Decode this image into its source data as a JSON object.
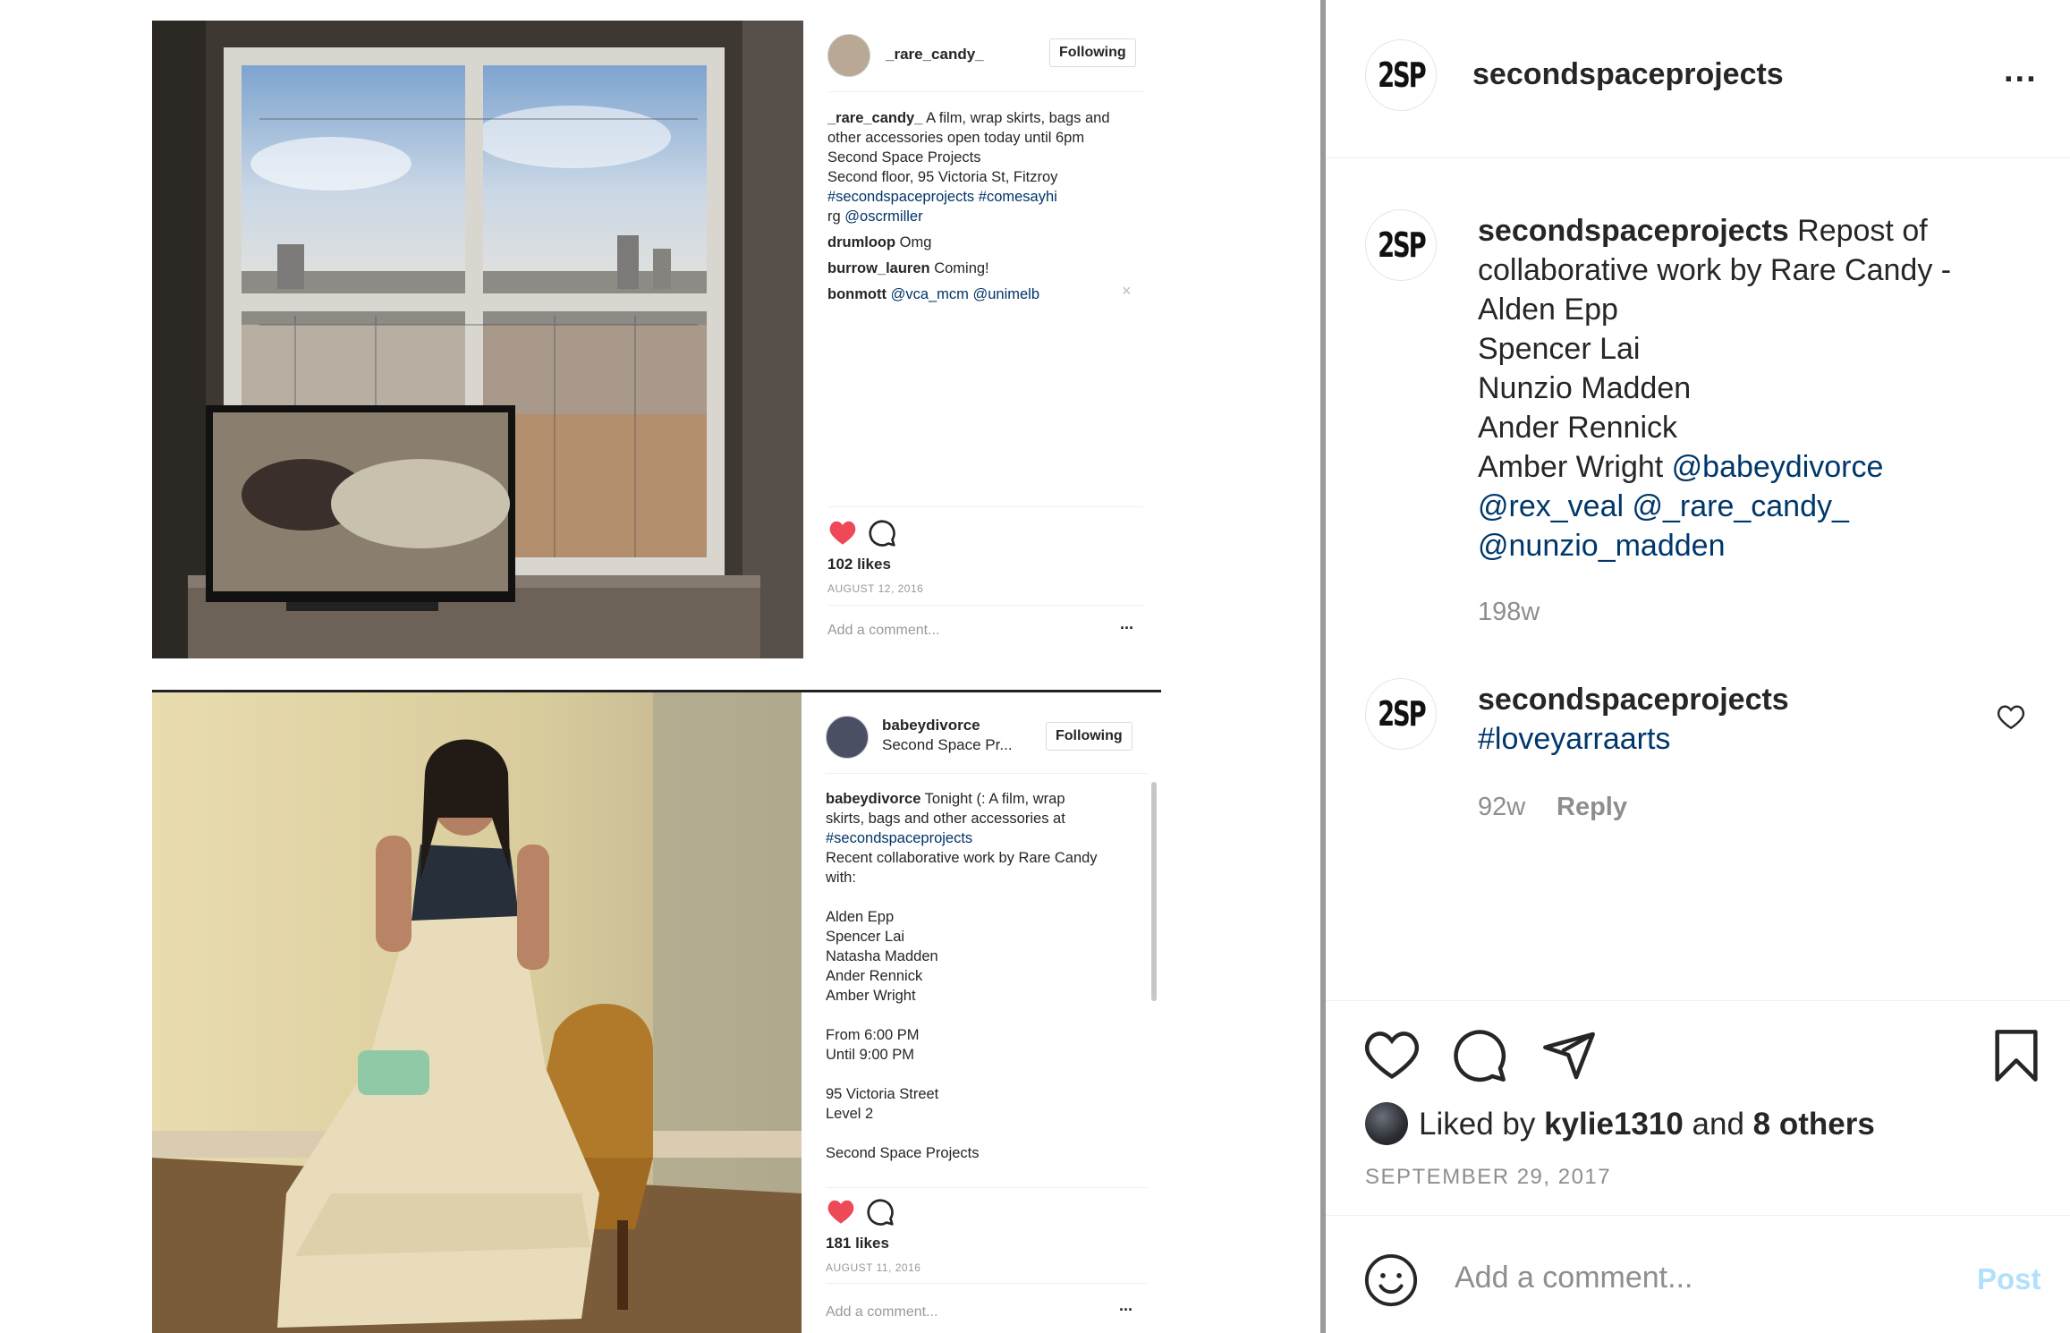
{
  "colors": {
    "accent": "#0095f6",
    "link": "#00376b",
    "heart_red": "#ed4956",
    "muted": "#8e8e8e"
  },
  "post_image": {
    "top": {
      "username": "_rare_candy_",
      "follow_label": "Following",
      "caption_user": "_rare_candy_",
      "caption_lines": [
        " A film, wrap skirts, bags and",
        "other accessories open today until 6pm",
        "Second Space Projects",
        "Second floor, 95 Victoria St, Fitzroy"
      ],
      "hashtags": "#secondspaceprojects #comesayhi",
      "rg_prefix": "rg ",
      "rg_mention": "@oscrmiller",
      "comments": [
        {
          "user": "drumloop",
          "text": " Omg"
        },
        {
          "user": "burrow_lauren",
          "text": " Coming!"
        },
        {
          "user": "bonmott",
          "text": " @vca_mcm @unimelb"
        }
      ],
      "likes": "102 likes",
      "date": "AUGUST 12, 2016",
      "add_comment": "Add a comment...",
      "more": "...",
      "close": "×"
    },
    "bottom": {
      "username": "babeydivorce",
      "location": "Second Space Pr...",
      "follow_label": "Following",
      "caption_user": "babeydivorce",
      "caption_first": " Tonight (: A film, wrap",
      "caption_lines": [
        "skirts, bags and other accessories at"
      ],
      "hashtag": "#secondspaceprojects",
      "body_lines": [
        "Recent collaborative work by Rare Candy",
        "with:",
        "",
        "Alden Epp",
        "Spencer Lai",
        "Natasha Madden",
        "Ander Rennick",
        "Amber Wright",
        "",
        "From 6:00 PM",
        "Until 9:00 PM",
        "",
        "95 Victoria Street",
        "Level 2",
        "",
        "Second Space Projects"
      ],
      "likes": "181 likes",
      "date": "AUGUST 11, 2016",
      "add_comment": "Add a comment...",
      "more": "..."
    }
  },
  "header": {
    "avatar_text": "2SP",
    "username": "secondspaceprojects",
    "more": "..."
  },
  "caption": {
    "avatar_text": "2SP",
    "username": "secondspaceprojects",
    "text_first": " Repost of",
    "lines": [
      "collaborative work by Rare Candy -",
      "Alden Epp",
      "Spencer Lai",
      "Nunzio Madden",
      "Ander Rennick"
    ],
    "amber": "Amber Wright ",
    "mentions_1": "@babeydivorce",
    "mentions_2": "@rex_veal @_rare_candy_",
    "mentions_3": "@nunzio_madden",
    "age": "198w"
  },
  "comment": {
    "avatar_text": "2SP",
    "username": "secondspaceprojects",
    "hashtag": "#loveyarraarts",
    "age": "92w",
    "reply": "Reply"
  },
  "actions": {
    "liked_by_prefix": "Liked by ",
    "liked_by_user": "kylie1310",
    "liked_by_mid": " and ",
    "liked_by_others": "8 others",
    "date": "SEPTEMBER 29, 2017"
  },
  "add_comment": {
    "placeholder": "Add a comment...",
    "post_label": "Post"
  }
}
